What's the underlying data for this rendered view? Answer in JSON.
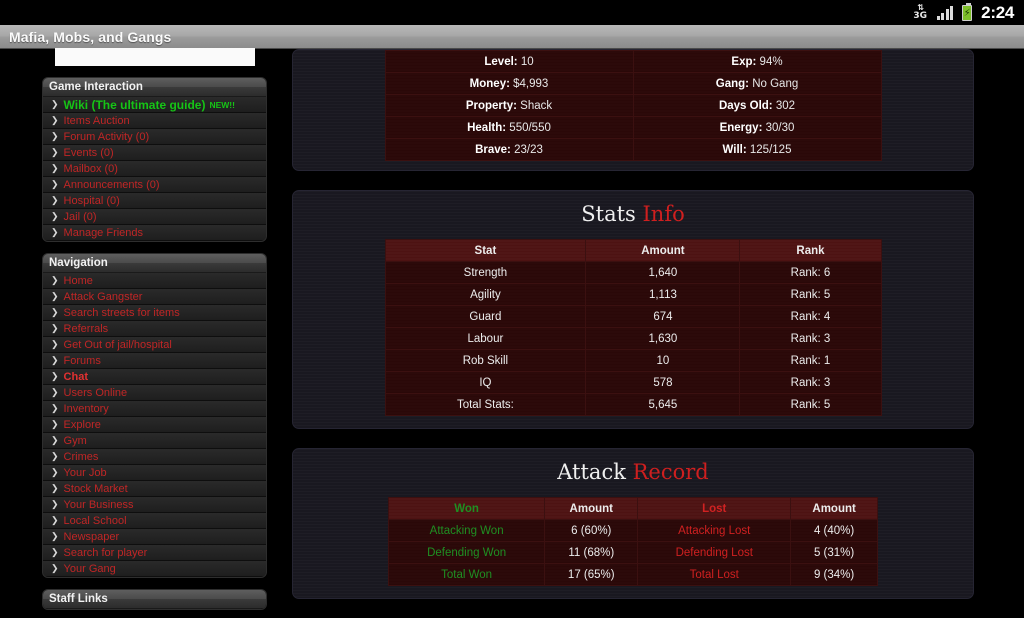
{
  "status_bar": {
    "data_icon": "3g-data-icon",
    "signal_icon": "signal-bars-icon",
    "battery_icon": "battery-icon",
    "time": "2:24"
  },
  "browser": {
    "title": "Mafia, Mobs, and Gangs"
  },
  "sidebar": {
    "sections": [
      {
        "title": "Game Interaction",
        "items": [
          {
            "label": "Wiki (The ultimate guide)",
            "badge": "NEW!!",
            "style": "wiki"
          },
          {
            "label": "Items Auction",
            "style": "normal"
          },
          {
            "label": "Forum Activity (0)",
            "style": "normal"
          },
          {
            "label": "Events (0)",
            "style": "normal"
          },
          {
            "label": "Mailbox (0)",
            "style": "normal"
          },
          {
            "label": "Announcements (0)",
            "style": "normal"
          },
          {
            "label": "Hospital (0)",
            "style": "normal"
          },
          {
            "label": "Jail (0)",
            "style": "normal"
          },
          {
            "label": "Manage Friends",
            "style": "normal"
          }
        ]
      },
      {
        "title": "Navigation",
        "items": [
          {
            "label": "Home",
            "style": "normal"
          },
          {
            "label": "Attack Gangster",
            "style": "normal"
          },
          {
            "label": "Search streets for items",
            "style": "normal"
          },
          {
            "label": "Referrals",
            "style": "normal"
          },
          {
            "label": "Get Out of jail/hospital",
            "style": "normal"
          },
          {
            "label": "Forums",
            "style": "normal"
          },
          {
            "label": "Chat",
            "style": "active"
          },
          {
            "label": "Users Online",
            "style": "normal"
          },
          {
            "label": "Inventory",
            "style": "normal"
          },
          {
            "label": "Explore",
            "style": "normal"
          },
          {
            "label": "Gym",
            "style": "normal"
          },
          {
            "label": "Crimes",
            "style": "normal"
          },
          {
            "label": "Your Job",
            "style": "normal"
          },
          {
            "label": "Stock Market",
            "style": "normal"
          },
          {
            "label": "Your Business",
            "style": "normal"
          },
          {
            "label": "Local School",
            "style": "normal"
          },
          {
            "label": "Newspaper",
            "style": "normal"
          },
          {
            "label": "Search for player",
            "style": "normal"
          },
          {
            "label": "Your Gang",
            "style": "normal"
          }
        ]
      },
      {
        "title": "Staff Links",
        "items": []
      }
    ]
  },
  "main": {
    "player_stats": {
      "rows": [
        [
          {
            "label": "Level:",
            "value": "10"
          },
          {
            "label": "Exp:",
            "value": "94%"
          }
        ],
        [
          {
            "label": "Money:",
            "value": "$4,993"
          },
          {
            "label": "Gang:",
            "value": "No Gang"
          }
        ],
        [
          {
            "label": "Property:",
            "value": "Shack"
          },
          {
            "label": "Days Old:",
            "value": "302"
          }
        ],
        [
          {
            "label": "Health:",
            "value": "550/550"
          },
          {
            "label": "Energy:",
            "value": "30/30"
          }
        ],
        [
          {
            "label": "Brave:",
            "value": "23/23"
          },
          {
            "label": "Will:",
            "value": "125/125"
          }
        ]
      ]
    },
    "stats_info": {
      "title_main": "Stats",
      "title_accent": "Info",
      "columns": [
        "Stat",
        "Amount",
        "Rank"
      ],
      "rows": [
        [
          "Strength",
          "1,640",
          "Rank: 6"
        ],
        [
          "Agility",
          "1,113",
          "Rank: 5"
        ],
        [
          "Guard",
          "674",
          "Rank: 4"
        ],
        [
          "Labour",
          "1,630",
          "Rank: 3"
        ],
        [
          "Rob Skill",
          "10",
          "Rank: 1"
        ],
        [
          "IQ",
          "578",
          "Rank: 3"
        ],
        [
          "Total Stats:",
          "5,645",
          "Rank: 5"
        ]
      ]
    },
    "attack_record": {
      "title_main": "Attack",
      "title_accent": "Record",
      "columns": [
        "Won",
        "Amount",
        "Lost",
        "Amount"
      ],
      "rows": [
        [
          "Attacking Won",
          "6 (60%)",
          "Attacking Lost",
          "4 (40%)"
        ],
        [
          "Defending Won",
          "11 (68%)",
          "Defending Lost",
          "5 (31%)"
        ],
        [
          "Total Won",
          "17 (65%)",
          "Total Lost",
          "9 (34%)"
        ]
      ]
    }
  },
  "colors": {
    "accent_red": "#cf1f1f",
    "link_red": "#c02626",
    "wiki_green": "#16c416",
    "won_green": "#1f8f22",
    "lost_red": "#cf2020",
    "table_row_bg": "#2a0808",
    "table_head_bg": "#4d1212"
  }
}
